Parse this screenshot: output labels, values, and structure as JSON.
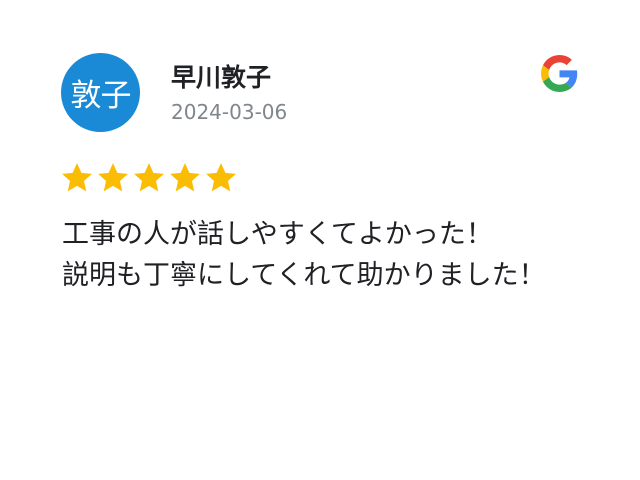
{
  "review": {
    "avatar_text": "敦子",
    "avatar_color": "#1a8ad6",
    "reviewer_name": "早川敦子",
    "date": "2024-03-06",
    "rating": 5,
    "rating_max": 5,
    "star_color": "#fbbc04",
    "source_icon": "google-g-icon",
    "text": "工事の人が話しやすくてよかった！\n説明も丁寧にしてくれて助かりました！"
  }
}
